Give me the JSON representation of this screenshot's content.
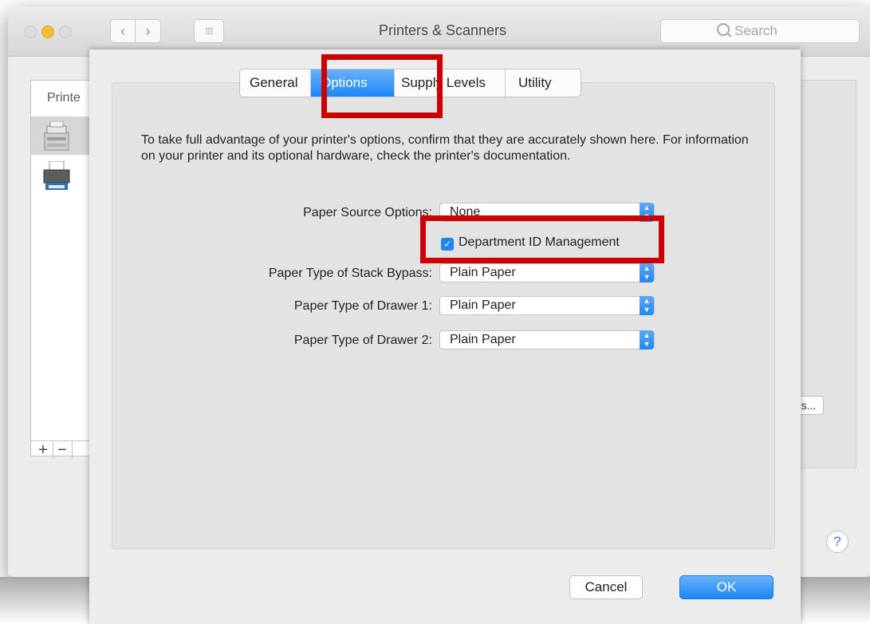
{
  "window": {
    "title": "Printers & Scanners",
    "search_placeholder": "Search",
    "nav_back": "‹",
    "nav_forward": "›",
    "grid_glyph": "⁞⁞⁞⁞"
  },
  "printer_list": {
    "label": "Printe",
    "add_label": "+",
    "remove_label": "−"
  },
  "right_panel": {
    "button_fragment": "s...",
    "help_label": "?"
  },
  "tabs": {
    "general": "General",
    "options": "Options",
    "supply_levels": "Supply Levels",
    "utility": "Utility"
  },
  "intro_text": "To take full advantage of your printer's options, confirm that they are accurately shown here. For information on your printer and its optional hardware, check the printer's documentation.",
  "options": {
    "paper_source": {
      "label": "Paper Source Options:",
      "value": "None"
    },
    "department_id": {
      "label": "Department ID Management",
      "checked": true
    },
    "stack_bypass": {
      "label": "Paper Type of Stack Bypass:",
      "value": "Plain Paper"
    },
    "drawer1": {
      "label": "Paper Type of Drawer 1:",
      "value": "Plain Paper"
    },
    "drawer2": {
      "label": "Paper Type of Drawer 2:",
      "value": "Plain Paper"
    }
  },
  "buttons": {
    "cancel": "Cancel",
    "ok": "OK"
  },
  "colors": {
    "accent": "#1b87f5",
    "annotation": "#cc0000"
  }
}
